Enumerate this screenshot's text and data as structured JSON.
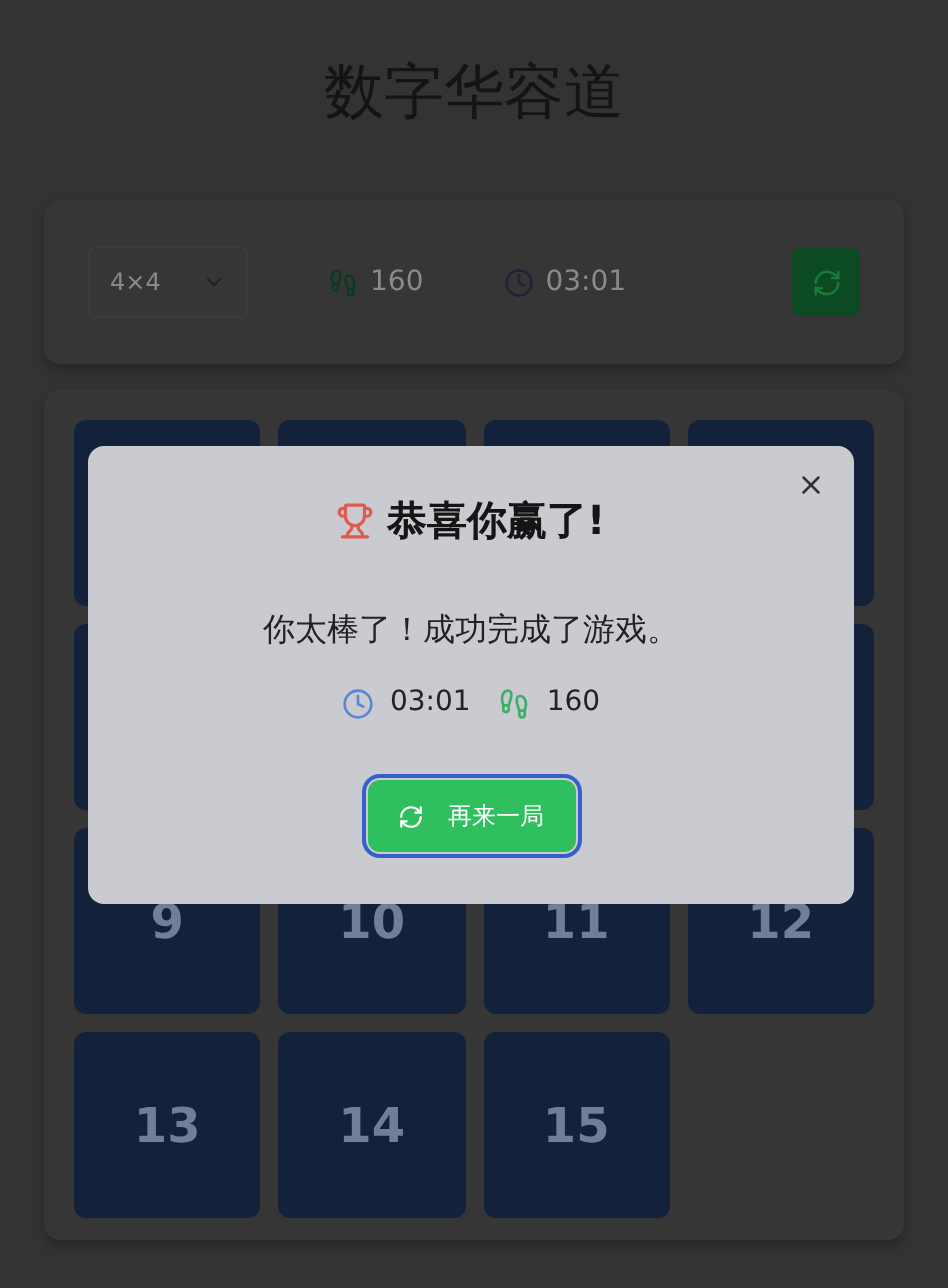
{
  "title": "数字华容道",
  "controls": {
    "size_select": "4×4",
    "moves": "160",
    "time": "03:01"
  },
  "tiles": [
    {
      "kind": "tile"
    },
    {
      "kind": "tile"
    },
    {
      "kind": "tile"
    },
    {
      "kind": "tile"
    },
    {
      "kind": "tile"
    },
    {
      "kind": "covered"
    },
    {
      "kind": "covered"
    },
    {
      "kind": "tile"
    },
    {
      "kind": "tile",
      "label": "9"
    },
    {
      "kind": "tile",
      "label": "10"
    },
    {
      "kind": "tile",
      "label": "11"
    },
    {
      "kind": "tile",
      "label": "12"
    },
    {
      "kind": "tile",
      "label": "13"
    },
    {
      "kind": "tile",
      "label": "14"
    },
    {
      "kind": "tile",
      "label": "15"
    },
    {
      "kind": "empty"
    }
  ],
  "dialog": {
    "title": "恭喜你赢了!",
    "message": "你太棒了！成功完成了游戏。",
    "time": "03:01",
    "moves": "160",
    "button": "再来一局"
  }
}
